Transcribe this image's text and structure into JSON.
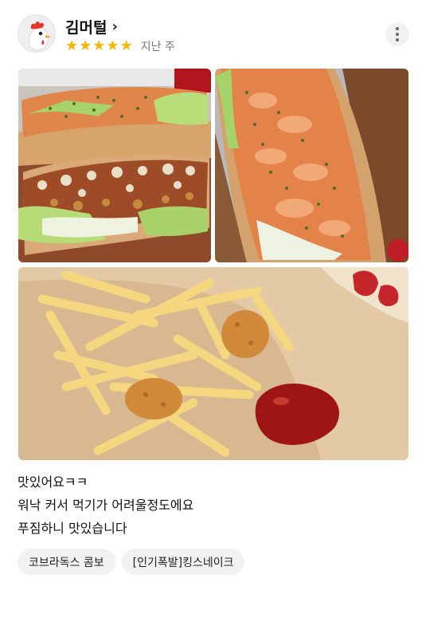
{
  "review": {
    "user_name": "김머털",
    "rating": 5,
    "rating_max": 5,
    "time_ago": "지난 주",
    "lines": [
      "맛있어요ㅋㅋ",
      "워낙 커서 먹기가 어려울정도에요",
      "푸짐하니 맛있습니다"
    ],
    "menu_tags": [
      "코브라독스 콤보",
      "[인기폭발]킹스네이크"
    ],
    "photos": [
      {
        "subject": "two-hotdogs-box-icon"
      },
      {
        "subject": "hotdog-closeup-icon"
      },
      {
        "subject": "fries-nuggets-ketchup-icon"
      }
    ]
  },
  "colors": {
    "star": "#f7b500",
    "tag_bg": "#f2f2f4"
  }
}
